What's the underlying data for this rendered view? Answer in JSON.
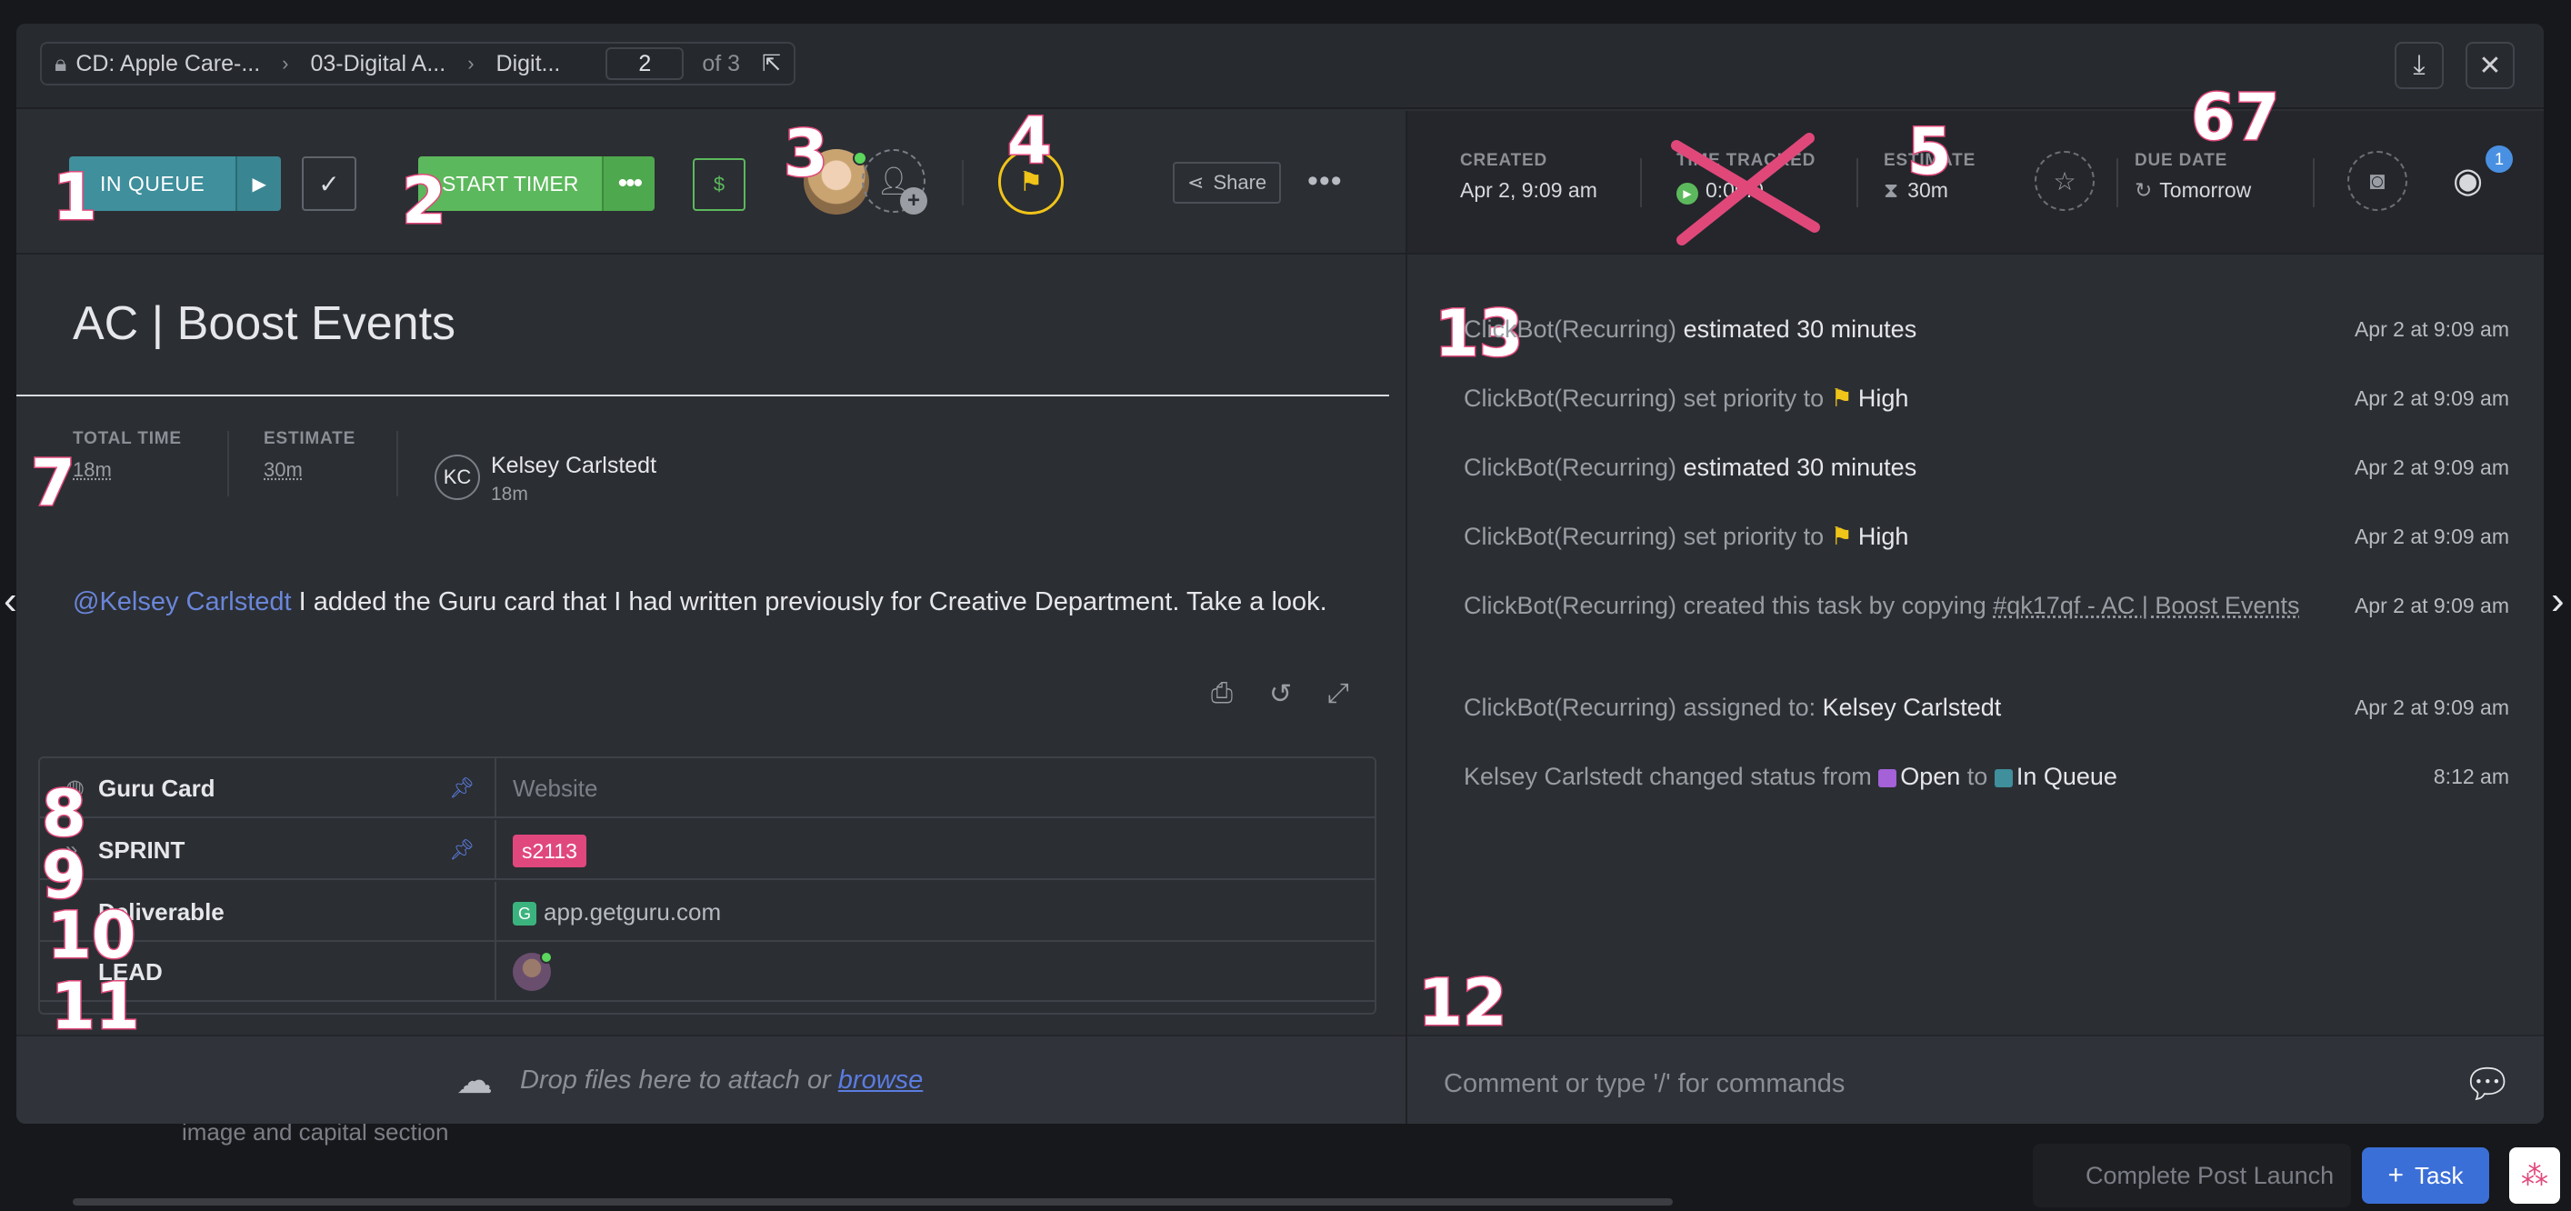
{
  "breadcrumb": {
    "items": [
      "CD: Apple Care-...",
      "03-Digital A...",
      "Digit..."
    ],
    "page_number": "2",
    "page_of": "of 3"
  },
  "toolbar": {
    "status_label": "IN QUEUE",
    "timer_label": "START TIMER",
    "dollar_label": "$",
    "share_label": "Share"
  },
  "meta": {
    "created_label": "CREATED",
    "created_value": "Apr 2, 9:09 am",
    "time_tracked_label": "TIME TRACKED",
    "time_tracked_value": "0:00:0",
    "estimate_label": "ESTIMATE",
    "estimate_value": "30m",
    "due_label": "DUE DATE",
    "due_value": "Tomorrow",
    "watchers_count": "1"
  },
  "task": {
    "title": "AC | Boost Events",
    "total_time_label": "TOTAL TIME",
    "total_time_value": "18m",
    "estimate_label": "ESTIMATE",
    "estimate_value": "30m",
    "assignee_initials": "KC",
    "assignee_name": "Kelsey Carlstedt",
    "assignee_time": "18m",
    "description_mention": "@Kelsey Carlstedt",
    "description_text": " I added the Guru card that I had written previously for Creative Department. Take a look."
  },
  "fields": [
    {
      "name": "Guru Card",
      "value": "Website",
      "pinned": true
    },
    {
      "name": "SPRINT",
      "value": "s2113",
      "pinned": true
    },
    {
      "name": "Deliverable",
      "value": "app.getguru.com",
      "pinned": false
    },
    {
      "name": "LEAD",
      "value": "",
      "pinned": false
    }
  ],
  "dropzone": {
    "text": "Drop files here to attach or ",
    "link": "browse"
  },
  "activity": [
    {
      "actor": "ClickBot(Recurring)",
      "action": " estimated 30 minutes",
      "time": "Apr 2 at 9:09 am"
    },
    {
      "actor": "ClickBot(Recurring)",
      "action": " set priority to ",
      "value": "High",
      "time": "Apr 2 at 9:09 am"
    },
    {
      "actor": "ClickBot(Recurring)",
      "action": " estimated 30 minutes",
      "time": "Apr 2 at 9:09 am"
    },
    {
      "actor": "ClickBot(Recurring)",
      "action": " set priority to ",
      "value": "High",
      "time": "Apr 2 at 9:09 am"
    },
    {
      "actor": "ClickBot(Recurring)",
      "action": " created this task by copying ",
      "value": "#qk17qf - AC | Boost Events",
      "time": "Apr 2 at 9:09 am"
    },
    {
      "actor": "ClickBot(Recurring)",
      "action": " assigned to: ",
      "value": "Kelsey Carlstedt",
      "time": "Apr 2 at 9:09 am"
    },
    {
      "actor": "Kelsey Carlstedt",
      "action": " changed status from ",
      "from": "Open",
      "to_word": " to ",
      "to": "In Queue",
      "time": "8:12 am"
    }
  ],
  "comment": {
    "placeholder": "Comment or type '/' for commands"
  },
  "annotations": [
    "1",
    "2",
    "3",
    "4",
    "5",
    "67",
    "7",
    "8",
    "9",
    "10",
    "11",
    "12",
    "13"
  ],
  "background": {
    "item_text": "image and capital section",
    "footer_button": "Complete Post Launch",
    "task_button": "Task"
  },
  "colors": {
    "status": "#3f8f9c",
    "timer": "#5cb85c",
    "priority": "#f0c419",
    "tag": "#e0477d",
    "open_status": "#a461d8",
    "in_queue_status": "#3f8f9c",
    "accent": "#3b6fd8",
    "annotation": "#e0487a"
  }
}
